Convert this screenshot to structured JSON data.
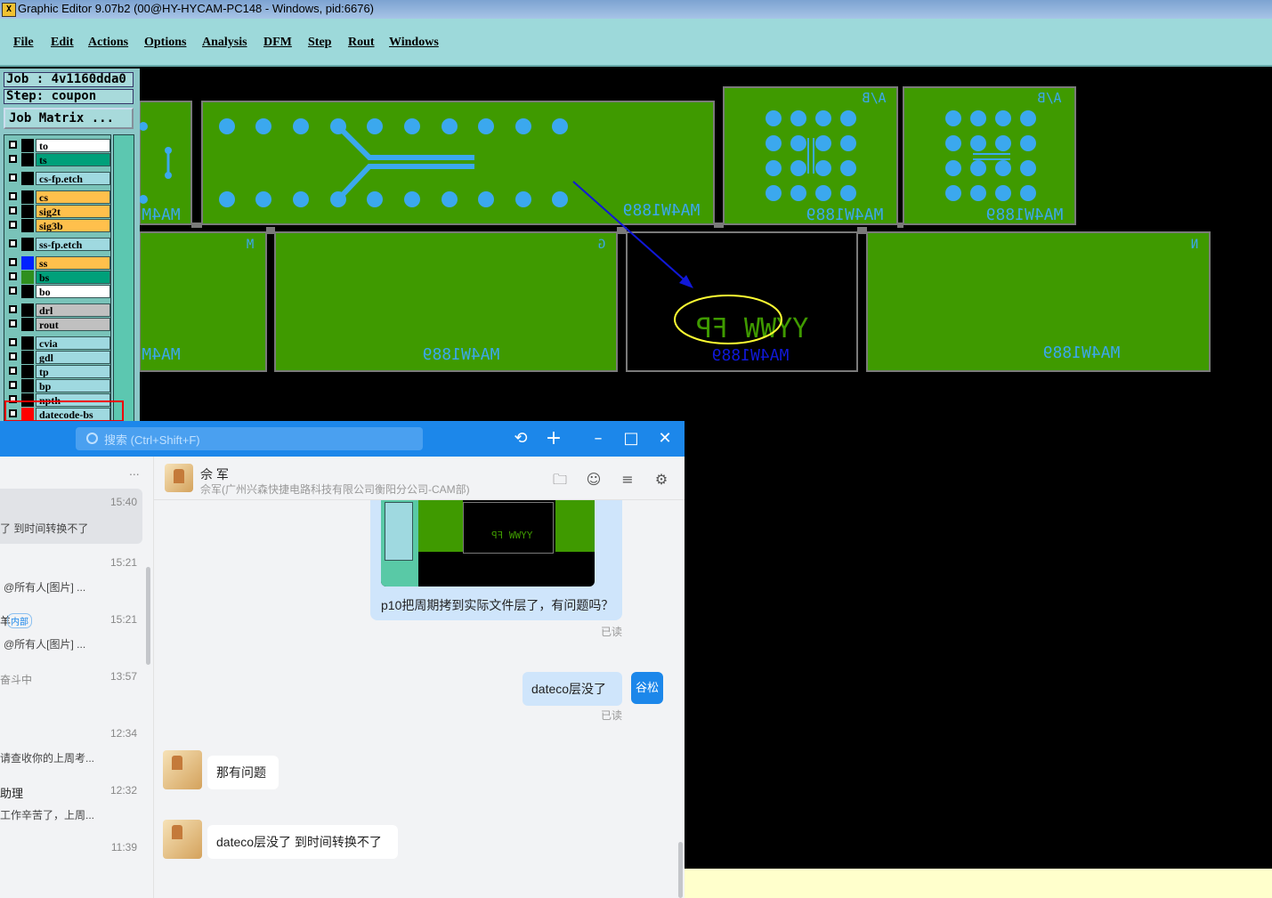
{
  "window": {
    "title": "Graphic Editor 9.07b2 (00@HY-HYCAM-PC148 - Windows, pid:6676)",
    "icon": "x-app-icon"
  },
  "menu": [
    "File",
    "Edit",
    "Actions",
    "Options",
    "Analysis",
    "DFM",
    "Step",
    "Rout",
    "Windows"
  ],
  "panel": {
    "job": "Job : 4v1160dda0",
    "step": "Step: coupon",
    "job_matrix": "Job Matrix ..."
  },
  "layers": [
    {
      "name": "to",
      "bg": "#ffffff",
      "color": "#000000"
    },
    {
      "name": "ts",
      "bg": "#00a07a",
      "color": "#000000"
    },
    {
      "name": "cs-fp.etch",
      "bg": "#9fd9e0",
      "color": "#000000"
    },
    {
      "name": "cs",
      "bg": "#ffc04c",
      "color": "#000000"
    },
    {
      "name": "sig2t",
      "bg": "#ffc04c",
      "color": "#000000"
    },
    {
      "name": "sig3b",
      "bg": "#ffc04c",
      "color": "#000000"
    },
    {
      "name": "ss-fp.etch",
      "bg": "#9fd9e0",
      "color": "#000000"
    },
    {
      "name": "ss",
      "bg": "#ffc04c",
      "color": "#0022ff"
    },
    {
      "name": "bs",
      "bg": "#00a07a",
      "color": "#2f8f1f"
    },
    {
      "name": "bo",
      "bg": "#ffffff",
      "color": "#000000"
    },
    {
      "name": "drl",
      "bg": "#c0c0c0",
      "color": "#000000"
    },
    {
      "name": "rout",
      "bg": "#c0c0c0",
      "color": "#000000"
    },
    {
      "name": "cvia",
      "bg": "#9fd9e0",
      "color": "#000000"
    },
    {
      "name": "gdl",
      "bg": "#9fd9e0",
      "color": "#000000"
    },
    {
      "name": "tp",
      "bg": "#9fd9e0",
      "color": "#000000"
    },
    {
      "name": "bp",
      "bg": "#9fd9e0",
      "color": "#000000"
    },
    {
      "name": "npth",
      "bg": "#9fd9e0",
      "color": "#000000"
    },
    {
      "name": "datecode-bs",
      "bg": "#9fd9e0",
      "color": "#ff0000"
    }
  ],
  "canvas": {
    "part_text": "MA4W1889",
    "partial_text": "MA4M",
    "corner_labels": [
      "A/B",
      "A/B"
    ],
    "small_labels": [
      "M",
      "G",
      "N"
    ],
    "date_code": "YYWW FP",
    "colors": {
      "board": "#3f9a00",
      "pad": "#3ba8ee",
      "outline": "#7a7a7a",
      "marker": "#ffff33",
      "arrow": "#1018d8"
    }
  },
  "chat": {
    "search_placeholder": "搜索 (Ctrl+Shift+F)",
    "header_icons": [
      "history-icon",
      "add-icon",
      "minimize-icon",
      "maximize-icon",
      "close-icon"
    ],
    "conversations": [
      {
        "time": "15:40",
        "preview": "了 到时间转换不了"
      },
      {
        "time": "15:21",
        "preview": "@所有人[图片] ..."
      },
      {
        "time": "15:21",
        "title": "羊",
        "tag": "内部",
        "preview": "@所有人[图片] ..."
      },
      {
        "time": "13:57",
        "preview": "奋斗中"
      },
      {
        "time": "12:34",
        "preview": "请查收你的上周考..."
      },
      {
        "time": "12:32",
        "title": "助理",
        "preview": "工作辛苦了，上周..."
      },
      {
        "time": "11:39",
        "preview": ""
      }
    ],
    "more_icon": "...",
    "contact": {
      "name": "佘 军",
      "org": "佘军(广州兴森快捷电路科技有限公司衡阳分公司-CAM部)"
    },
    "toolbar_icons": [
      "folder-icon",
      "add-person-icon",
      "search-history-icon",
      "settings-icon"
    ],
    "messages": [
      {
        "side": "right",
        "type": "image_text",
        "text": "p10把周期拷到实际文件层了，有问题吗？",
        "thumb_text": "YYWW FP",
        "read": "已读"
      },
      {
        "side": "right",
        "text": "dateco层没了",
        "avatar": "谷松",
        "read": "已读"
      },
      {
        "side": "left",
        "text": "那有问题"
      },
      {
        "side": "left",
        "text": "dateco层没了 到时间转换不了"
      }
    ]
  }
}
